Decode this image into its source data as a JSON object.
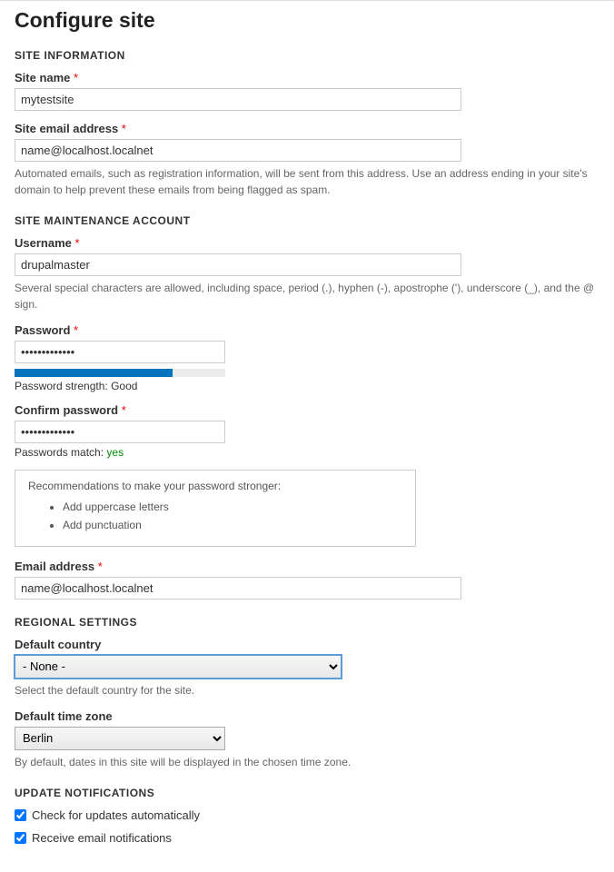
{
  "page_title": "Configure site",
  "sections": {
    "site_info": {
      "heading": "SITE INFORMATION",
      "site_name": {
        "label": "Site name",
        "value": "mytestsite"
      },
      "site_email": {
        "label": "Site email address",
        "value": "name@localhost.localnet",
        "description": "Automated emails, such as registration information, will be sent from this address. Use an address ending in your site's domain to help prevent these emails from being flagged as spam."
      }
    },
    "maintenance": {
      "heading": "SITE MAINTENANCE ACCOUNT",
      "username": {
        "label": "Username",
        "value": "drupalmaster",
        "description": "Several special characters are allowed, including space, period (.), hyphen (-), apostrophe ('), underscore (_), and the @ sign."
      },
      "password": {
        "label": "Password",
        "value": "•••••••••••••",
        "strength_label": "Password strength:",
        "strength_value": "Good",
        "strength_percent": "75"
      },
      "confirm": {
        "label": "Confirm password",
        "value": "•••••••••••••",
        "match_label": "Passwords match:",
        "match_value": "yes"
      },
      "recommendations": {
        "title": "Recommendations to make your password stronger:",
        "items": [
          "Add uppercase letters",
          "Add punctuation"
        ]
      },
      "email": {
        "label": "Email address",
        "value": "name@localhost.localnet"
      }
    },
    "regional": {
      "heading": "REGIONAL SETTINGS",
      "country": {
        "label": "Default country",
        "selected": "- None -",
        "description": "Select the default country for the site."
      },
      "timezone": {
        "label": "Default time zone",
        "selected": "Berlin",
        "description": "By default, dates in this site will be displayed in the chosen time zone."
      }
    },
    "updates": {
      "heading": "UPDATE NOTIFICATIONS",
      "check_auto": {
        "label": "Check for updates automatically",
        "checked": true
      },
      "receive_email": {
        "label": "Receive email notifications",
        "checked": true
      }
    }
  }
}
